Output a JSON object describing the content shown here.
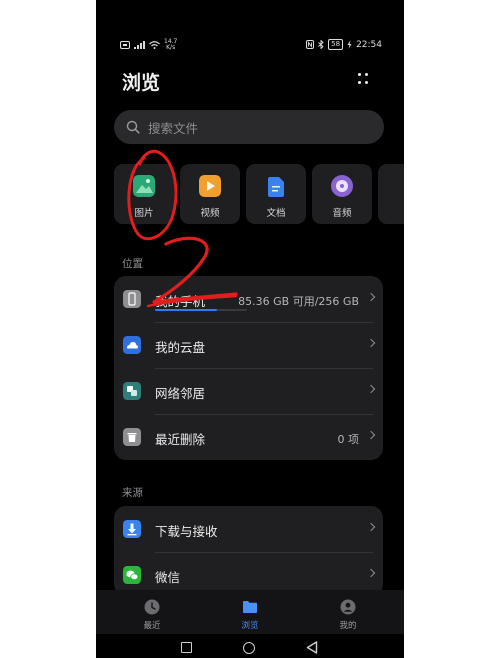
{
  "status_bar": {
    "speed_value": "14.7",
    "speed_unit": "K/s",
    "battery": "58",
    "time": "22:54"
  },
  "header": {
    "title": "浏览"
  },
  "search": {
    "placeholder": "搜索文件"
  },
  "categories": [
    {
      "label": "图片",
      "icon": "image-icon",
      "color": "#2aa876"
    },
    {
      "label": "视频",
      "icon": "video-icon",
      "color": "#f0a030"
    },
    {
      "label": "文档",
      "icon": "document-icon",
      "color": "#3a82f0"
    },
    {
      "label": "音频",
      "icon": "audio-icon",
      "color": "#8a63d2"
    }
  ],
  "locations": {
    "section_title": "位置",
    "items": [
      {
        "label": "我的手机",
        "value": "85.36 GB 可用/256 GB",
        "icon": "phone-icon",
        "storage_used_fraction": 0.67
      },
      {
        "label": "我的云盘",
        "value": "",
        "icon": "cloud-icon"
      },
      {
        "label": "网络邻居",
        "value": "",
        "icon": "network-icon"
      },
      {
        "label": "最近删除",
        "value": "0 项",
        "icon": "trash-icon"
      }
    ]
  },
  "sources": {
    "section_title": "来源",
    "items": [
      {
        "label": "下载与接收",
        "icon": "download-icon"
      },
      {
        "label": "微信",
        "icon": "wechat-icon"
      }
    ]
  },
  "tabs": [
    {
      "label": "最近",
      "icon": "clock-icon",
      "active": false
    },
    {
      "label": "浏览",
      "icon": "folder-icon",
      "active": true
    },
    {
      "label": "我的",
      "icon": "profile-icon",
      "active": false
    }
  ],
  "annotations": {
    "handwritten_number": "2"
  }
}
